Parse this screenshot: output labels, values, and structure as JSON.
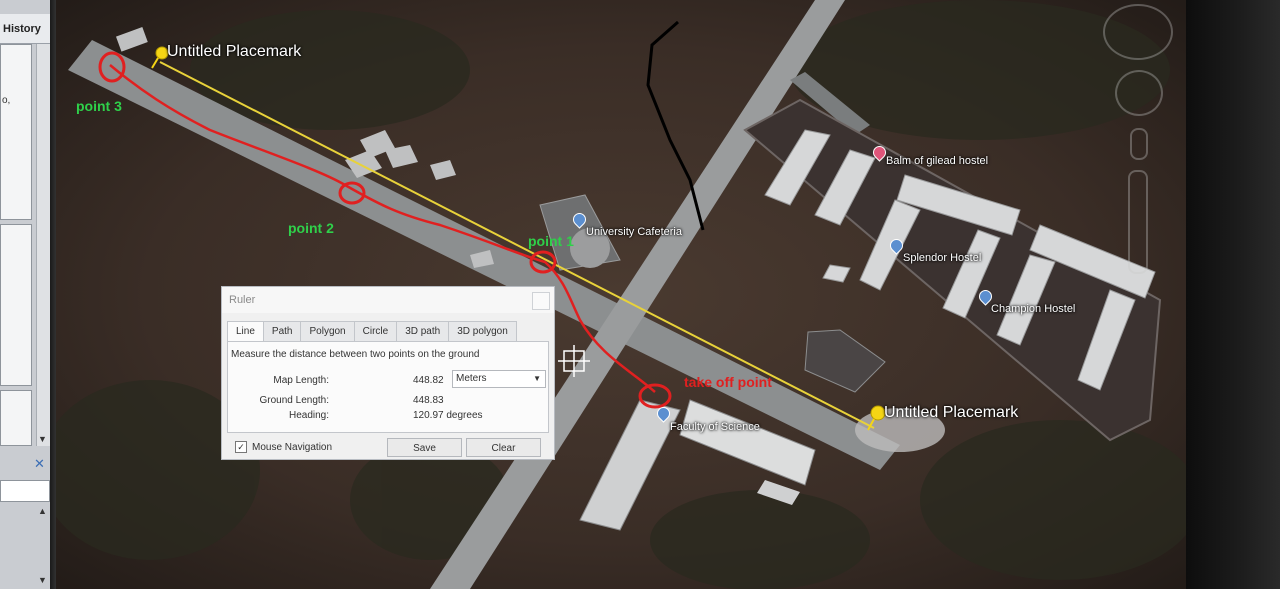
{
  "history_panel": {
    "title": "History",
    "side_text": "o,"
  },
  "map": {
    "placemarks": [
      {
        "label": "Untitled Placemark"
      },
      {
        "label": "Untitled Placemark"
      }
    ],
    "pois": [
      {
        "label": "University Cafeteria",
        "icon": "place-pin-icon",
        "color": "#5b8fd0"
      },
      {
        "label": "Balm of gilead hostel",
        "icon": "place-pin-icon",
        "color": "#e0557a"
      },
      {
        "label": "Splendor Hostel",
        "icon": "place-pin-icon",
        "color": "#5b8fd0"
      },
      {
        "label": "Champion Hostel",
        "icon": "place-pin-icon",
        "color": "#5b8fd0"
      },
      {
        "label": "Faculty of Science",
        "icon": "place-pin-icon",
        "color": "#5b8fd0"
      }
    ],
    "annotations": {
      "point1": "point 1",
      "point2": "point 2",
      "point3": "point 3",
      "takeoff": "take off point"
    },
    "colors": {
      "measure_line": "#e8d23a",
      "annotation_red": "#e02020",
      "annotation_green": "#2fd04a"
    }
  },
  "ruler": {
    "title": "Ruler",
    "tabs": [
      "Line",
      "Path",
      "Polygon",
      "Circle",
      "3D path",
      "3D polygon"
    ],
    "active_tab": "Line",
    "description": "Measure the distance between two points on the ground",
    "map_length_label": "Map Length:",
    "map_length_value": "448.82",
    "unit": "Meters",
    "ground_length_label": "Ground Length:",
    "ground_length_value": "448.83",
    "heading_label": "Heading:",
    "heading_value": "120.97 degrees",
    "mouse_nav_label": "Mouse Navigation",
    "mouse_nav_checked": "✓",
    "save_label": "Save",
    "clear_label": "Clear"
  }
}
